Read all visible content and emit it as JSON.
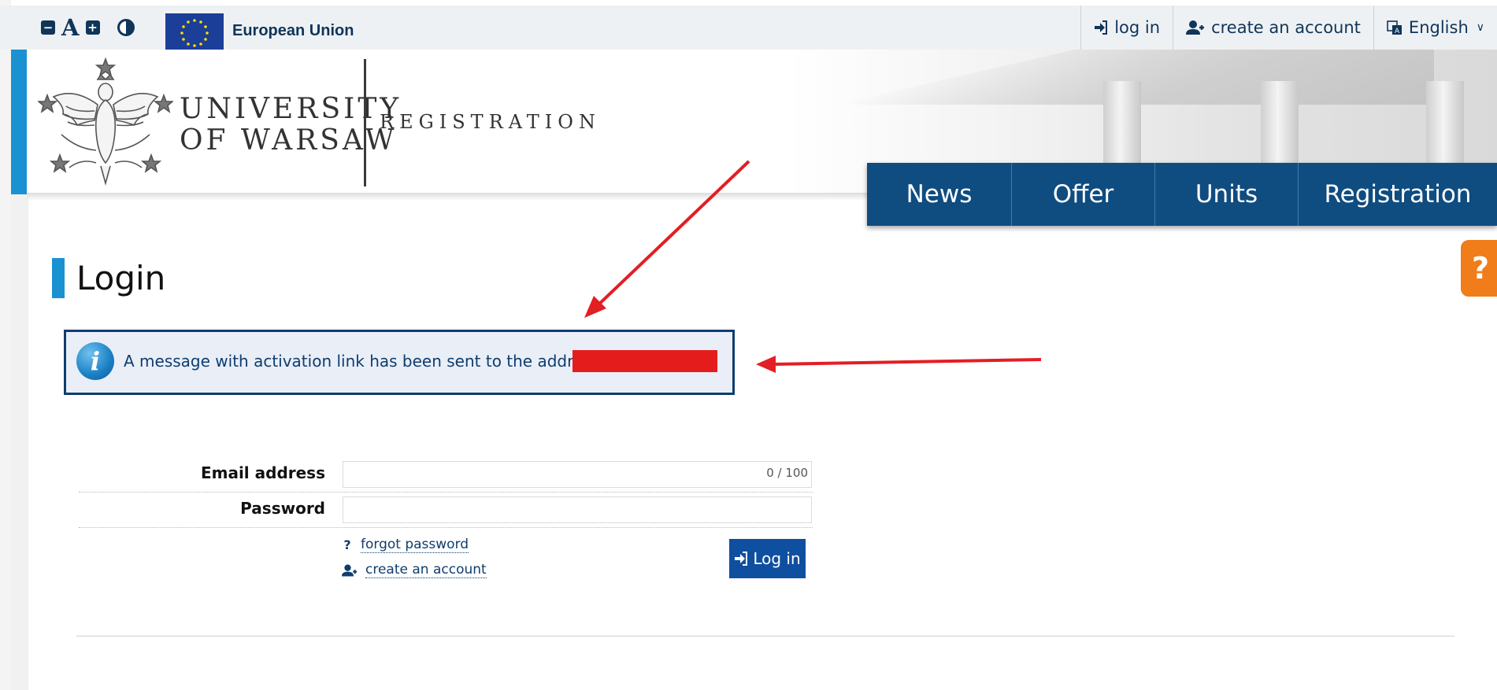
{
  "topbar": {
    "decrease_font_label": "−",
    "font_label": "A",
    "increase_font_label": "+",
    "eu_label": "European Union",
    "nav": {
      "login": "log in",
      "create_account": "create an account",
      "language": "English"
    }
  },
  "header": {
    "university_line1": "UNIVERSITY",
    "university_line2": "OF WARSAW",
    "section": "REGISTRATION"
  },
  "main_nav": [
    "News",
    "Offer",
    "Units",
    "Registration"
  ],
  "help_label": "?",
  "page": {
    "title": "Login",
    "info_message": "A message with activation link has been sent to the address:"
  },
  "form": {
    "email_label": "Email address",
    "email_value": "",
    "email_counter": "0 / 100",
    "password_label": "Password",
    "password_value": "",
    "forgot_password": "forgot password",
    "create_account": "create an account",
    "login_button": "Log in"
  },
  "colors": {
    "brand_navy": "#0f4c80",
    "accent_blue": "#1a91d0",
    "help_orange": "#f07c1a",
    "redaction_red": "#e51c1c",
    "annotation_arrow": "#e31e24"
  },
  "icons": [
    "decrease-font-icon",
    "increase-font-icon",
    "contrast-icon",
    "eu-flag-icon",
    "login-icon",
    "user-plus-icon",
    "language-icon",
    "chevron-down-icon",
    "university-eagle-emblem",
    "info-icon",
    "question-icon"
  ]
}
